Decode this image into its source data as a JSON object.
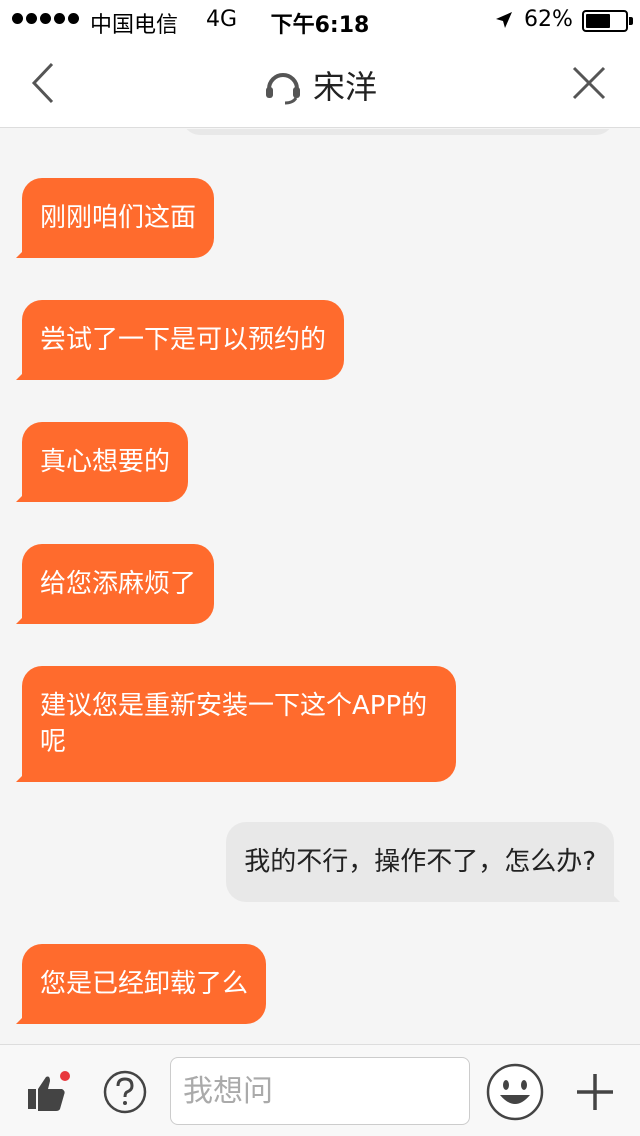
{
  "status_bar": {
    "carrier": "中国电信",
    "network": "4G",
    "time": "下午6:18",
    "battery_percent_text": "62%",
    "battery_level": 0.62
  },
  "header": {
    "title": "宋洋",
    "icons": {
      "back": "chevron-left-icon",
      "agent": "headset-icon",
      "close": "close-icon"
    }
  },
  "messages": [
    {
      "side": "left",
      "text": "刚刚咱们这面"
    },
    {
      "side": "left",
      "text": "尝试了一下是可以预约的"
    },
    {
      "side": "left",
      "text": "真心想要的"
    },
    {
      "side": "left",
      "text": "给您添麻烦了"
    },
    {
      "side": "left",
      "text": "建议您是重新安装一下这个APP的呢"
    },
    {
      "side": "right",
      "text": "我的不行，操作不了，怎么办?"
    },
    {
      "side": "left",
      "text": "您是已经卸载了么"
    }
  ],
  "input_bar": {
    "placeholder": "我想问",
    "icons": {
      "like": "thumbs-up-icon",
      "help": "question-icon",
      "emoji": "emoji-icon",
      "plus": "plus-icon"
    }
  },
  "colors": {
    "agent_bubble": "#ff6b2d",
    "user_bubble": "#e8e8e8",
    "badge": "#e8383d"
  }
}
